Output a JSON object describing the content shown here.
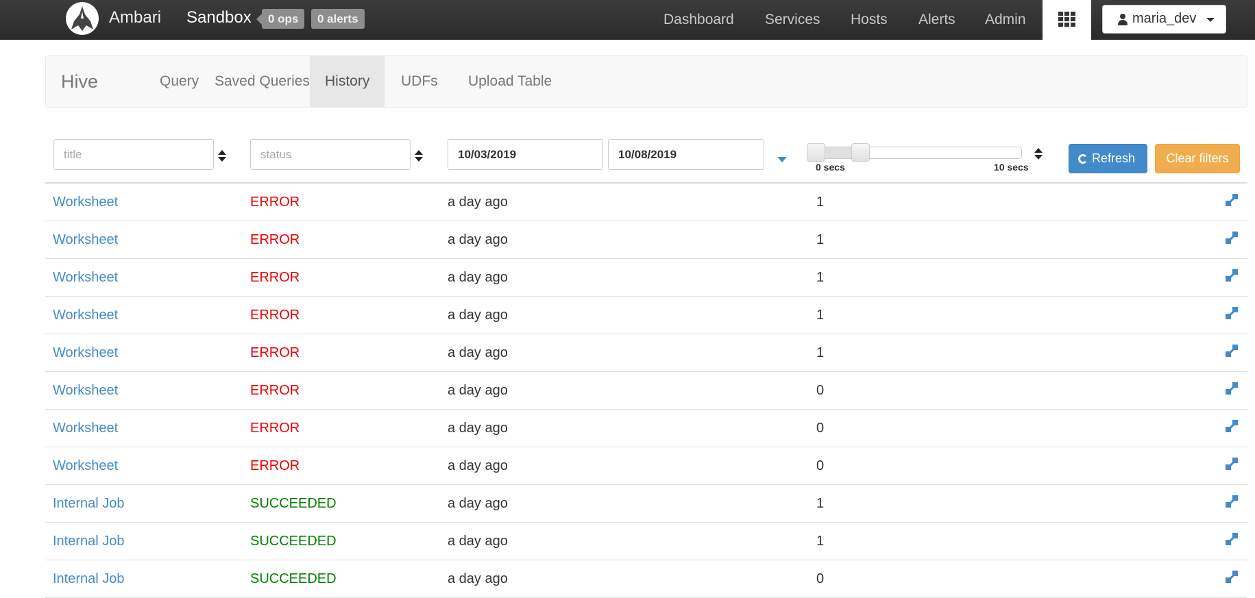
{
  "topbar": {
    "app_name": "Ambari",
    "cluster_name": "Sandbox",
    "ops_badge": "0 ops",
    "alerts_badge": "0 alerts",
    "nav": [
      "Dashboard",
      "Services",
      "Hosts",
      "Alerts",
      "Admin"
    ],
    "user": "maria_dev"
  },
  "subnav": {
    "brand": "Hive",
    "tabs": [
      "Query",
      "Saved Queries",
      "History",
      "UDFs",
      "Upload Table"
    ],
    "active_tab": "History"
  },
  "filters": {
    "title_placeholder": "title",
    "status_placeholder": "status",
    "date_from": "10/03/2019",
    "date_to": "10/08/2019",
    "duration_min_label": "0 secs",
    "duration_max_label": "10 secs",
    "refresh_label": "Refresh",
    "clear_label": "Clear filters"
  },
  "history": [
    {
      "title": "Worksheet",
      "status": "ERROR",
      "date": "a day ago",
      "duration": "1"
    },
    {
      "title": "Worksheet",
      "status": "ERROR",
      "date": "a day ago",
      "duration": "1"
    },
    {
      "title": "Worksheet",
      "status": "ERROR",
      "date": "a day ago",
      "duration": "1"
    },
    {
      "title": "Worksheet",
      "status": "ERROR",
      "date": "a day ago",
      "duration": "1"
    },
    {
      "title": "Worksheet",
      "status": "ERROR",
      "date": "a day ago",
      "duration": "1"
    },
    {
      "title": "Worksheet",
      "status": "ERROR",
      "date": "a day ago",
      "duration": "0"
    },
    {
      "title": "Worksheet",
      "status": "ERROR",
      "date": "a day ago",
      "duration": "0"
    },
    {
      "title": "Worksheet",
      "status": "ERROR",
      "date": "a day ago",
      "duration": "0"
    },
    {
      "title": "Internal Job",
      "status": "SUCCEEDED",
      "date": "a day ago",
      "duration": "1"
    },
    {
      "title": "Internal Job",
      "status": "SUCCEEDED",
      "date": "a day ago",
      "duration": "1"
    },
    {
      "title": "Internal Job",
      "status": "SUCCEEDED",
      "date": "a day ago",
      "duration": "0"
    }
  ],
  "colors": {
    "link": "#428bca",
    "error": "#ee0000",
    "success": "#008000",
    "refresh": "#428bca",
    "clear": "#f0ad4e"
  }
}
